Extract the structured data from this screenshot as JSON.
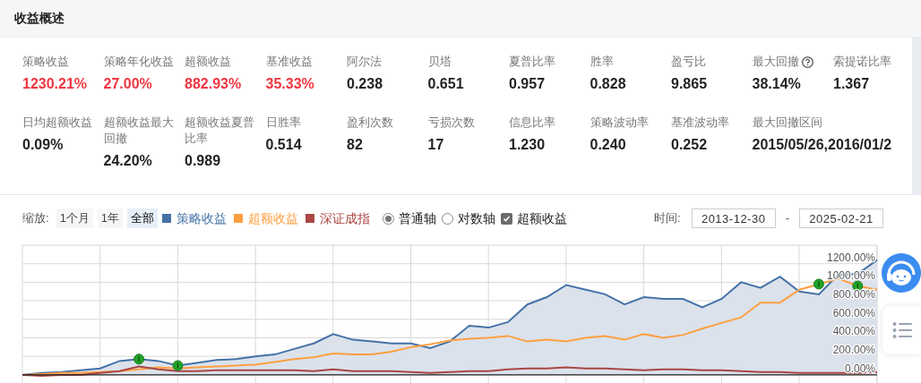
{
  "header": {
    "title": "收益概述"
  },
  "metric_rows": [
    [
      {
        "label": "策略收益",
        "value": "1230.21%",
        "positive": true,
        "help": false
      },
      {
        "label": "策略年化收益",
        "value": "27.00%",
        "positive": true,
        "help": false
      },
      {
        "label": "超额收益",
        "value": "882.93%",
        "positive": true,
        "help": false
      },
      {
        "label": "基准收益",
        "value": "35.33%",
        "positive": true,
        "help": false
      },
      {
        "label": "阿尔法",
        "value": "0.238",
        "positive": false,
        "help": false
      },
      {
        "label": "贝塔",
        "value": "0.651",
        "positive": false,
        "help": false
      },
      {
        "label": "夏普比率",
        "value": "0.957",
        "positive": false,
        "help": false
      },
      {
        "label": "胜率",
        "value": "0.828",
        "positive": false,
        "help": false
      },
      {
        "label": "盈亏比",
        "value": "9.865",
        "positive": false,
        "help": false
      },
      {
        "label": "最大回撤",
        "value": "38.14%",
        "positive": false,
        "help": true
      },
      {
        "label": "索提诺比率",
        "value": "1.367",
        "positive": false,
        "help": false
      }
    ],
    [
      {
        "label": "日均超额收益",
        "value": "0.09%",
        "positive": false,
        "help": false
      },
      {
        "label": "超额收益最大回撤",
        "value": "24.20%",
        "positive": false,
        "help": false
      },
      {
        "label": "超额收益夏普比率",
        "value": "0.989",
        "positive": false,
        "help": false
      },
      {
        "label": "日胜率",
        "value": "0.514",
        "positive": false,
        "help": false
      },
      {
        "label": "盈利次数",
        "value": "82",
        "positive": false,
        "help": false
      },
      {
        "label": "亏损次数",
        "value": "17",
        "positive": false,
        "help": false
      },
      {
        "label": "信息比率",
        "value": "1.230",
        "positive": false,
        "help": false
      },
      {
        "label": "策略波动率",
        "value": "0.240",
        "positive": false,
        "help": false
      },
      {
        "label": "基准波动率",
        "value": "0.252",
        "positive": false,
        "help": false
      },
      {
        "label": "最大回撤区间",
        "value": "2015/05/26,2016/01/2",
        "positive": false,
        "help": false
      }
    ]
  ],
  "toolbar": {
    "zoom_label": "缩放:",
    "zoom_buttons": [
      {
        "label": "1个月",
        "selected": false
      },
      {
        "label": "1年",
        "selected": false
      },
      {
        "label": "全部",
        "selected": true
      }
    ],
    "axis_options": [
      {
        "label": "普通轴",
        "selected": true
      },
      {
        "label": "对数轴",
        "selected": false
      }
    ],
    "excess_toggle": {
      "label": "超额收益",
      "checked": true
    },
    "time_label": "时间:",
    "start_date": "2013-12-30",
    "separator": "-",
    "end_date": "2025-02-21"
  },
  "chart_data": {
    "type": "line",
    "grid": true,
    "yticks": [
      {
        "value": 0,
        "label": "0.00%"
      },
      {
        "value": 200,
        "label": "200.00%"
      },
      {
        "value": 400,
        "label": "400.00%"
      },
      {
        "value": 600,
        "label": "600.00%"
      },
      {
        "value": 800,
        "label": "800.00%"
      },
      {
        "value": 1000,
        "label": "1000.00%"
      },
      {
        "value": 1200,
        "label": "1200.00%"
      }
    ],
    "ylim": [
      -120,
      1400
    ],
    "series": [
      {
        "name": "策略收益",
        "color": "#4572a7",
        "values": [
          0,
          20,
          30,
          50,
          70,
          150,
          170,
          150,
          100,
          130,
          160,
          170,
          200,
          220,
          280,
          340,
          440,
          380,
          360,
          340,
          340,
          290,
          360,
          530,
          510,
          570,
          760,
          840,
          970,
          920,
          870,
          760,
          840,
          820,
          820,
          730,
          820,
          1000,
          940,
          1060,
          900,
          870,
          1080,
          1090,
          1240
        ]
      },
      {
        "name": "超额收益",
        "color": "#ff9f40",
        "values": [
          0,
          10,
          20,
          20,
          30,
          40,
          60,
          80,
          70,
          80,
          90,
          100,
          110,
          140,
          170,
          190,
          230,
          220,
          220,
          250,
          300,
          330,
          370,
          390,
          400,
          420,
          360,
          380,
          360,
          400,
          420,
          380,
          440,
          400,
          430,
          500,
          560,
          620,
          780,
          780,
          920,
          980,
          1040,
          960,
          920
        ]
      },
      {
        "name": "深证成指",
        "color": "#aa4643",
        "values": [
          0,
          -10,
          0,
          0,
          20,
          40,
          90,
          60,
          40,
          40,
          50,
          50,
          50,
          50,
          50,
          40,
          60,
          40,
          40,
          40,
          30,
          20,
          30,
          40,
          40,
          60,
          70,
          70,
          80,
          70,
          70,
          60,
          50,
          60,
          60,
          50,
          50,
          40,
          30,
          30,
          20,
          20,
          20,
          20,
          30
        ]
      }
    ]
  }
}
